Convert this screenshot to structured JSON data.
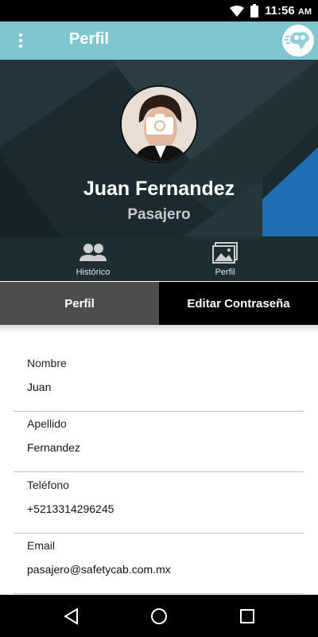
{
  "status_bar": {
    "time": "11:56",
    "ampm": "AM",
    "icons": [
      "wifi-icon",
      "battery-icon"
    ]
  },
  "app_bar": {
    "title": "Perfil",
    "menu_icon": "more-vert-icon",
    "logo_icon": "safetycab-logo"
  },
  "header": {
    "name": "Juan Fernandez",
    "role": "Pasajero",
    "camera_icon": "camera-icon",
    "nav": [
      {
        "label": "Histórico",
        "icon": "people-icon"
      },
      {
        "label": "Perfil",
        "icon": "photos-icon"
      }
    ]
  },
  "tabs": [
    {
      "label": "Perfil",
      "active": true
    },
    {
      "label": "Editar Contraseña",
      "active": false
    }
  ],
  "form": {
    "fields": [
      {
        "label": "Nombre",
        "value": "Juan"
      },
      {
        "label": "Apellido",
        "value": "Fernandez"
      },
      {
        "label": "Teléfono",
        "value": "+5213314296245"
      },
      {
        "label": "Email",
        "value": "pasajero@safetycab.com.mx"
      }
    ]
  },
  "colors": {
    "app_bar": "#7fc6cf",
    "header_bg": "#1b2b30",
    "accent_blue": "#1f6fb3",
    "tab_active": "#4d4d4d",
    "tab_inactive": "#000000"
  },
  "system_nav": [
    "back-icon",
    "home-icon",
    "recents-icon"
  ]
}
